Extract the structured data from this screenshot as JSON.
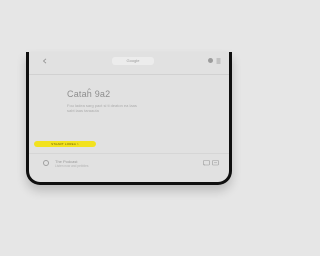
{
  "topbar": {
    "tab_label": "Google",
    "icons": {
      "back": "back-icon",
      "profile": "circle-icon",
      "menu": "menu-icon"
    }
  },
  "hero": {
    "title": "Cataĥ 9a2",
    "subtitle": "Fou ladea sarg pact si ti deaton ea laas sabt laas taraauta"
  },
  "cta": {
    "label": "STAART  LOREA  >"
  },
  "list_row": {
    "title": "The Podcast",
    "subtitle": "Listen now and pebbles",
    "icons": {
      "item": "circle-outline-icon",
      "cast": "cast-icon",
      "more": "more-icon"
    }
  },
  "colors": {
    "background": "#e6e6e6",
    "screen": "#e1e1e1",
    "bezel": "#0f0f0f",
    "accent": "#f2e21f",
    "text_muted": "#9a9a9a"
  }
}
